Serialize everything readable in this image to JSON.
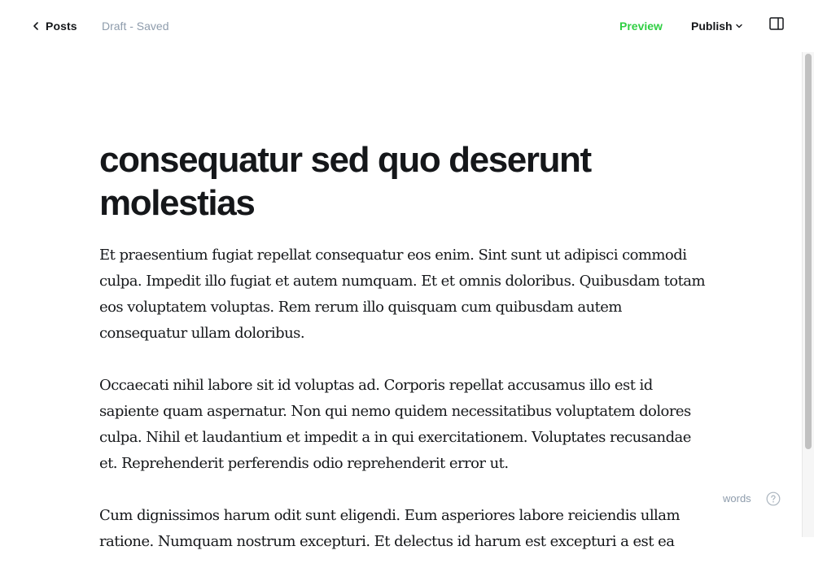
{
  "header": {
    "back_label": "Posts",
    "back_icon": "chevron-left-icon",
    "status": "Draft - Saved",
    "preview_label": "Preview",
    "publish_label": "Publish",
    "publish_icon": "chevron-down-icon",
    "sidebar_icon": "sidebar-toggle-icon"
  },
  "post": {
    "title": "consequatur sed quo deserunt molestias",
    "paragraphs": [
      "Et praesentium fugiat repellat consequatur eos enim. Sint sunt ut adipisci commodi culpa. Impedit illo fugiat et autem numquam. Et et omnis doloribus. Quibusdam totam eos voluptatem voluptas. Rem rerum illo quisquam cum quibusdam autem consequatur ullam doloribus.",
      "Occaecati nihil labore sit id voluptas ad. Corporis repellat accusamus illo est id sapiente quam aspernatur. Non qui nemo quidem necessitatibus voluptatem dolores culpa. Nihil et laudantium et impedit a in qui exercitationem. Voluptates recusandae et. Reprehenderit perferendis odio reprehenderit error ut.",
      "Cum dignissimos harum odit sunt eligendi. Eum asperiores labore reiciendis ullam ratione. Numquam nostrum excepturi. Et delectus id harum est excepturi a est ea"
    ]
  },
  "footer": {
    "word_count_label": "words",
    "help_icon": "help-icon"
  },
  "colors": {
    "accent_green": "#30cf43",
    "muted_text": "#8e9cac",
    "primary_text": "#15171a"
  }
}
